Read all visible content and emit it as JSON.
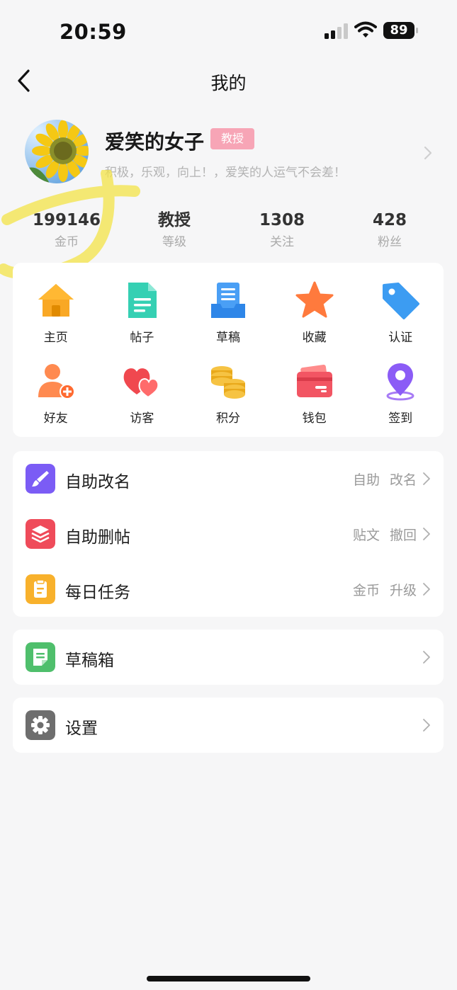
{
  "status_bar": {
    "time": "20:59",
    "battery": "89"
  },
  "nav": {
    "title": "我的"
  },
  "profile": {
    "name": "爱笑的女子",
    "badge": "教授",
    "bio": "积极，乐观，向上！，爱笑的人运气不会差！"
  },
  "stats": [
    {
      "value": "199146",
      "label": "金币"
    },
    {
      "value": "教授",
      "label": "等级"
    },
    {
      "value": "1308",
      "label": "关注"
    },
    {
      "value": "428",
      "label": "粉丝"
    }
  ],
  "grid": [
    {
      "label": "主页",
      "icon": "home-icon"
    },
    {
      "label": "帖子",
      "icon": "document-icon"
    },
    {
      "label": "草稿",
      "icon": "draft-tray-icon"
    },
    {
      "label": "收藏",
      "icon": "star-icon"
    },
    {
      "label": "认证",
      "icon": "tag-icon"
    },
    {
      "label": "好友",
      "icon": "add-friend-icon"
    },
    {
      "label": "访客",
      "icon": "hearts-icon"
    },
    {
      "label": "积分",
      "icon": "coins-icon"
    },
    {
      "label": "钱包",
      "icon": "wallet-icon"
    },
    {
      "label": "签到",
      "icon": "location-pin-icon"
    }
  ],
  "list": [
    {
      "label": "自助改名",
      "right1": "自助",
      "right2": "改名",
      "icon": "brush-icon",
      "color": "#7b5cf5"
    },
    {
      "label": "自助删帖",
      "right1": "贴文",
      "right2": "撤回",
      "icon": "layers-icon",
      "color": "#ef4b5a"
    },
    {
      "label": "每日任务",
      "right1": "金币",
      "right2": "升级",
      "icon": "clipboard-icon",
      "color": "#f8b12c"
    }
  ],
  "drafts": {
    "label": "草稿箱",
    "icon": "note-icon",
    "color": "#4fbf6c"
  },
  "settings": {
    "label": "设置",
    "icon": "gear-icon",
    "color": "#6e6e6e"
  }
}
